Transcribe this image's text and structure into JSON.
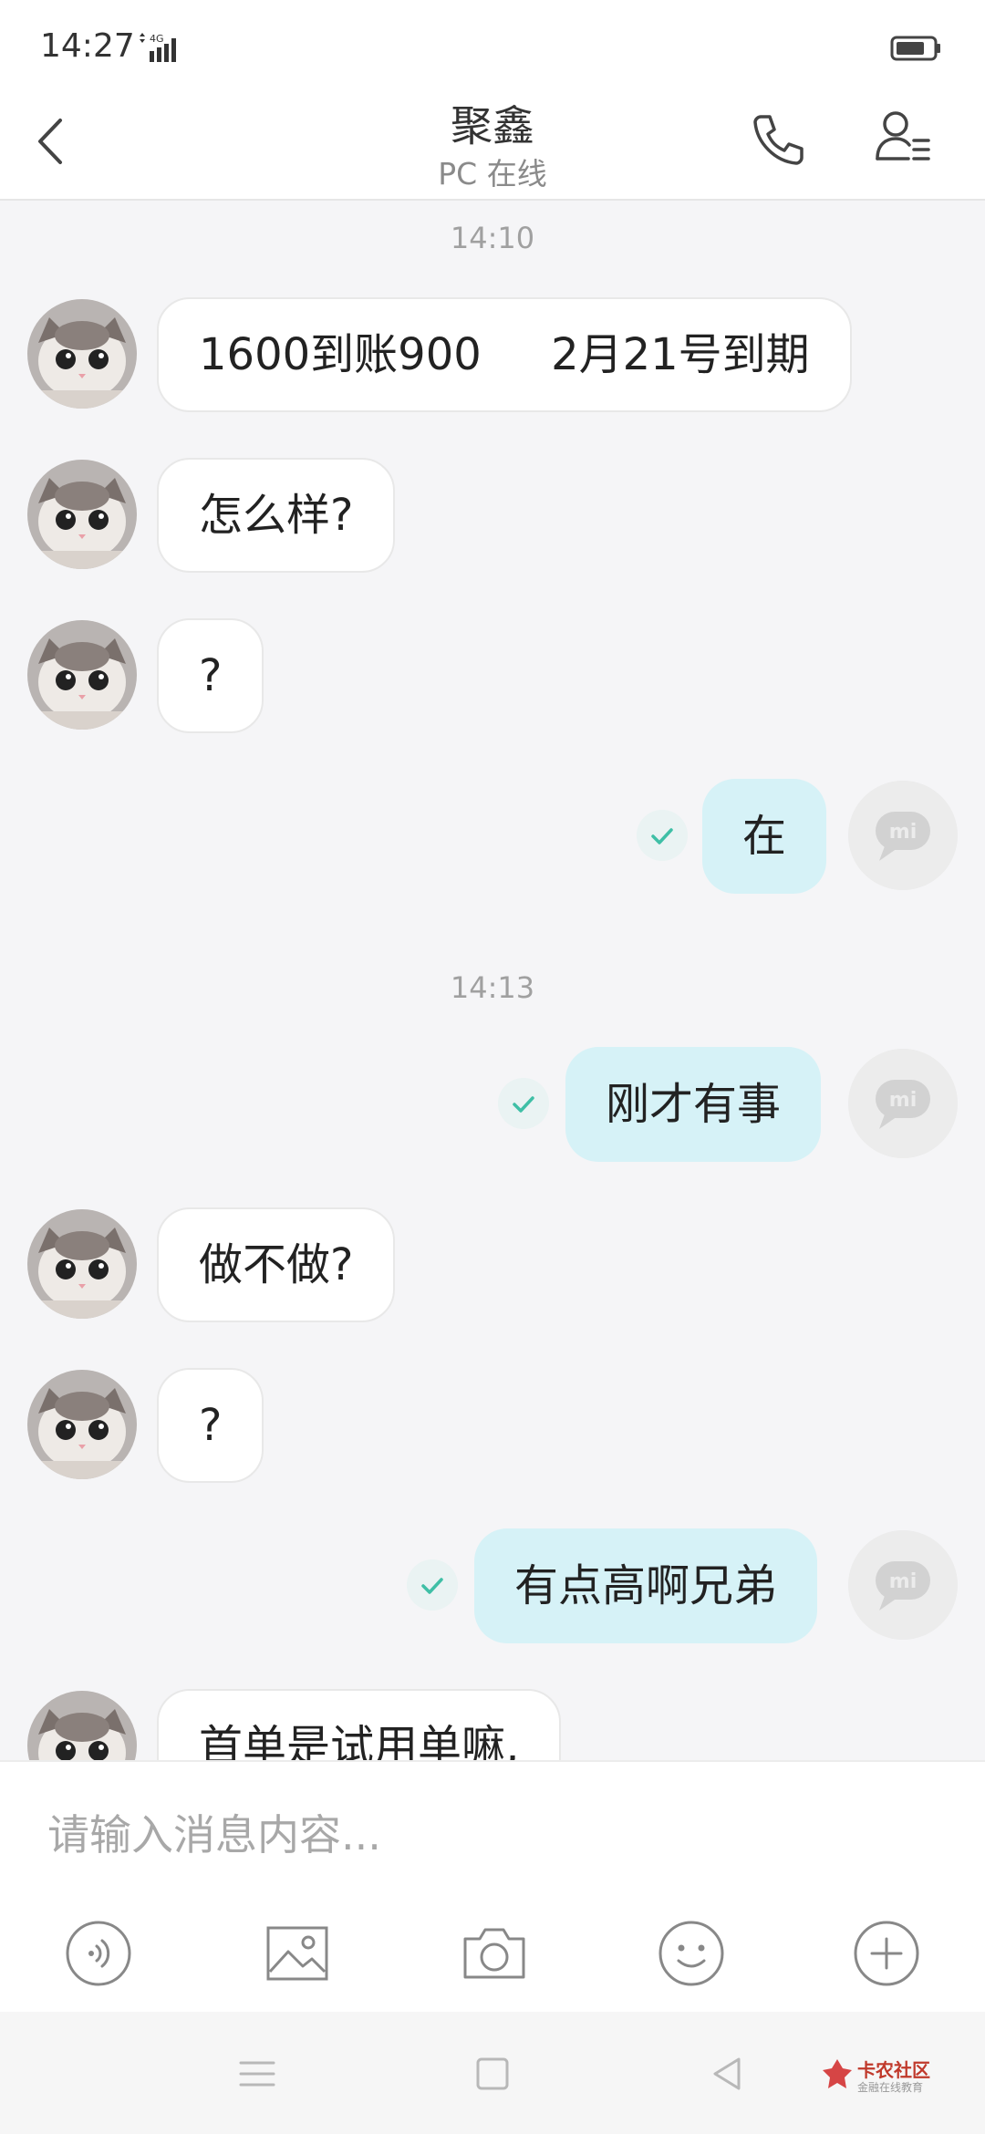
{
  "status_bar": {
    "time": "14:27",
    "network": "4G"
  },
  "header": {
    "title": "聚鑫",
    "subtitle": "PC 在线"
  },
  "messages": [
    {
      "type": "timestamp",
      "text": "14:10"
    },
    {
      "type": "in",
      "text": "1600到账900     2月21号到期"
    },
    {
      "type": "in",
      "text": "怎么样?"
    },
    {
      "type": "in",
      "text": "?"
    },
    {
      "type": "out",
      "text": "在",
      "status": "read"
    },
    {
      "type": "timestamp",
      "text": "14:13"
    },
    {
      "type": "out",
      "text": "刚才有事",
      "status": "read"
    },
    {
      "type": "in",
      "text": "做不做?"
    },
    {
      "type": "in",
      "text": "?"
    },
    {
      "type": "out",
      "text": "有点高啊兄弟",
      "status": "read"
    },
    {
      "type": "in",
      "text": "首单是试用单嘛,"
    }
  ],
  "input": {
    "placeholder": "请输入消息内容..."
  },
  "toolbar": [
    "voice-icon",
    "image-icon",
    "camera-icon",
    "emoji-icon",
    "plus-icon"
  ],
  "watermark": {
    "text": "卡农社区",
    "sub": "金融在线教育"
  },
  "colors": {
    "outgoing_bubble": "#d6f2f7",
    "incoming_bubble": "#ffffff",
    "check": "#3fbfa6",
    "background": "#f5f5f7"
  }
}
